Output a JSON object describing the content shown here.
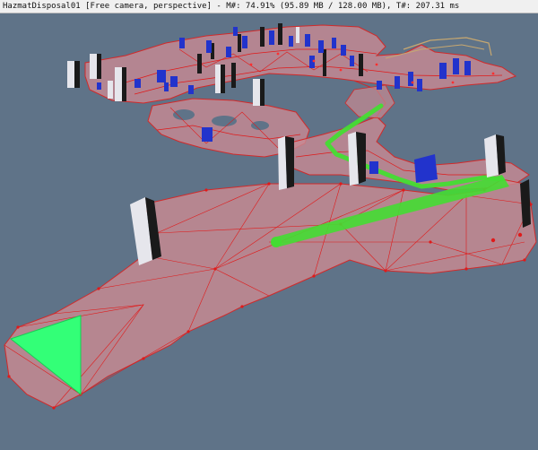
{
  "window": {
    "title": "HazmatDisposal01 [Free camera, perspective] - M#: 74.91% (95.89 MB / 128.00 MB), T#: 207.31 ms"
  },
  "viewport": {
    "type": "3d-navmesh-debug-view",
    "colors": {
      "background": "#5f7388",
      "navmesh_fill": "#c98a93",
      "navmesh_edge": "#e01a1a",
      "path": "#44dd33",
      "selection_triangle": "#33ff77",
      "marker_blue": "#2233cc",
      "pillar_light": "#e8e8ee",
      "pillar_dark": "#1a1a1a"
    },
    "icons": [
      "selection-triangle",
      "path-line",
      "obstacle-pillar",
      "cover-marker"
    ]
  }
}
